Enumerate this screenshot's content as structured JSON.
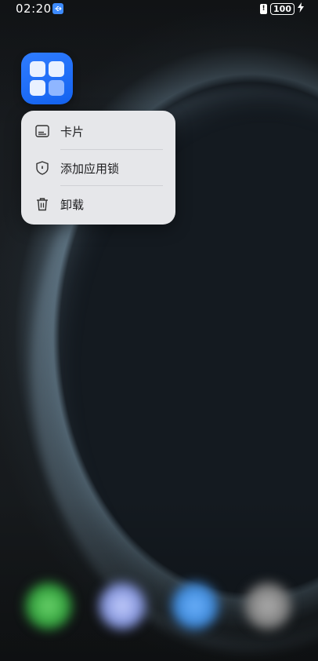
{
  "status_bar": {
    "time": "02:20",
    "battery_level": "100",
    "usb_icon": "usb-icon",
    "alert_icon": "battery-alert-icon",
    "charging_icon": "bolt-icon"
  },
  "app_icon": {
    "icon": "app-grid-icon",
    "color": "#1f6ff5"
  },
  "context_menu": {
    "items": [
      {
        "label": "卡片",
        "icon": "card-icon"
      },
      {
        "label": "添加应用锁",
        "icon": "shield-icon"
      },
      {
        "label": "卸载",
        "icon": "trash-icon"
      }
    ]
  },
  "dock": {
    "items": [
      {
        "icon": "phone-icon",
        "color": "#3fb54a"
      },
      {
        "icon": "messages-icon",
        "color": "#8ea0e6"
      },
      {
        "icon": "browser-icon",
        "color": "#4a95e0"
      },
      {
        "icon": "camera-icon",
        "color": "#8a8a8a"
      }
    ]
  }
}
